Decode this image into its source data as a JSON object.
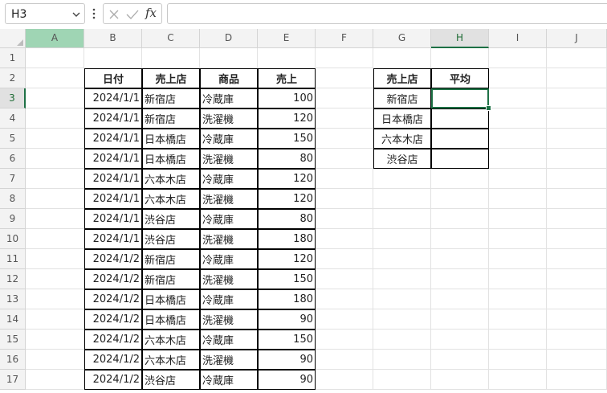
{
  "namebox": {
    "value": "H3"
  },
  "formula_bar": {
    "value": ""
  },
  "columns": [
    "A",
    "B",
    "C",
    "D",
    "E",
    "F",
    "G",
    "H",
    "I",
    "J"
  ],
  "rows": [
    "1",
    "2",
    "3",
    "4",
    "5",
    "6",
    "7",
    "8",
    "9",
    "10",
    "11",
    "12",
    "13",
    "14",
    "15",
    "16",
    "17"
  ],
  "sales_table": {
    "headers": [
      "日付",
      "売上店",
      "商品",
      "売上"
    ],
    "rows": [
      [
        "2024/1/1",
        "新宿店",
        "冷蔵庫",
        "100"
      ],
      [
        "2024/1/1",
        "新宿店",
        "洗濯機",
        "120"
      ],
      [
        "2024/1/1",
        "日本橋店",
        "冷蔵庫",
        "150"
      ],
      [
        "2024/1/1",
        "日本橋店",
        "洗濯機",
        "80"
      ],
      [
        "2024/1/1",
        "六本木店",
        "冷蔵庫",
        "120"
      ],
      [
        "2024/1/1",
        "六本木店",
        "洗濯機",
        "120"
      ],
      [
        "2024/1/1",
        "渋谷店",
        "冷蔵庫",
        "80"
      ],
      [
        "2024/1/1",
        "渋谷店",
        "洗濯機",
        "180"
      ],
      [
        "2024/1/2",
        "新宿店",
        "冷蔵庫",
        "120"
      ],
      [
        "2024/1/2",
        "新宿店",
        "洗濯機",
        "150"
      ],
      [
        "2024/1/2",
        "日本橋店",
        "冷蔵庫",
        "180"
      ],
      [
        "2024/1/2",
        "日本橋店",
        "洗濯機",
        "90"
      ],
      [
        "2024/1/2",
        "六本木店",
        "冷蔵庫",
        "150"
      ],
      [
        "2024/1/2",
        "六本木店",
        "洗濯機",
        "90"
      ],
      [
        "2024/1/2",
        "渋谷店",
        "冷蔵庫",
        "90"
      ]
    ]
  },
  "summary_table": {
    "headers": [
      "売上店",
      "平均"
    ],
    "rows": [
      [
        "新宿店",
        ""
      ],
      [
        "日本橋店",
        ""
      ],
      [
        "六本木店",
        ""
      ],
      [
        "渋谷店",
        ""
      ]
    ]
  },
  "colors": {
    "accent": "#1e7145",
    "selected_header": "#e1e1e1",
    "selected_col_a": "#9fd5b4"
  }
}
